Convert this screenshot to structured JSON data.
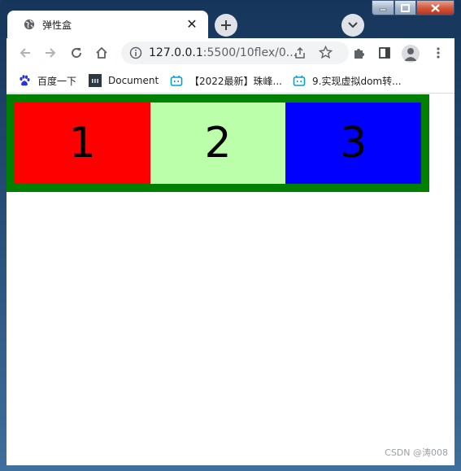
{
  "tab": {
    "title": "弹性盒",
    "close_glyph": "✕"
  },
  "toolbar": {
    "url_host": "127.0.0.1",
    "url_rest": ":5500/10flex/0..."
  },
  "bookmarks": [
    {
      "label": "百度一下",
      "icon": "baidu-paw-icon"
    },
    {
      "label": "Document",
      "icon": "document-icon"
    },
    {
      "label": "【2022最新】珠峰...",
      "icon": "bilibili-tv-icon"
    },
    {
      "label": "9.实现虚拟dom转...",
      "icon": "bilibili-tv-icon"
    }
  ],
  "page": {
    "container_color": "#008000",
    "items": [
      {
        "text": "1",
        "color": "#ff0000"
      },
      {
        "text": "2",
        "color": "#bbffaa"
      },
      {
        "text": "3",
        "color": "#0000ff"
      }
    ]
  },
  "watermark": "CSDN @涛008",
  "colors": {
    "accent_bilibili": "#00a1d6",
    "baidu_blue": "#2932e1"
  }
}
